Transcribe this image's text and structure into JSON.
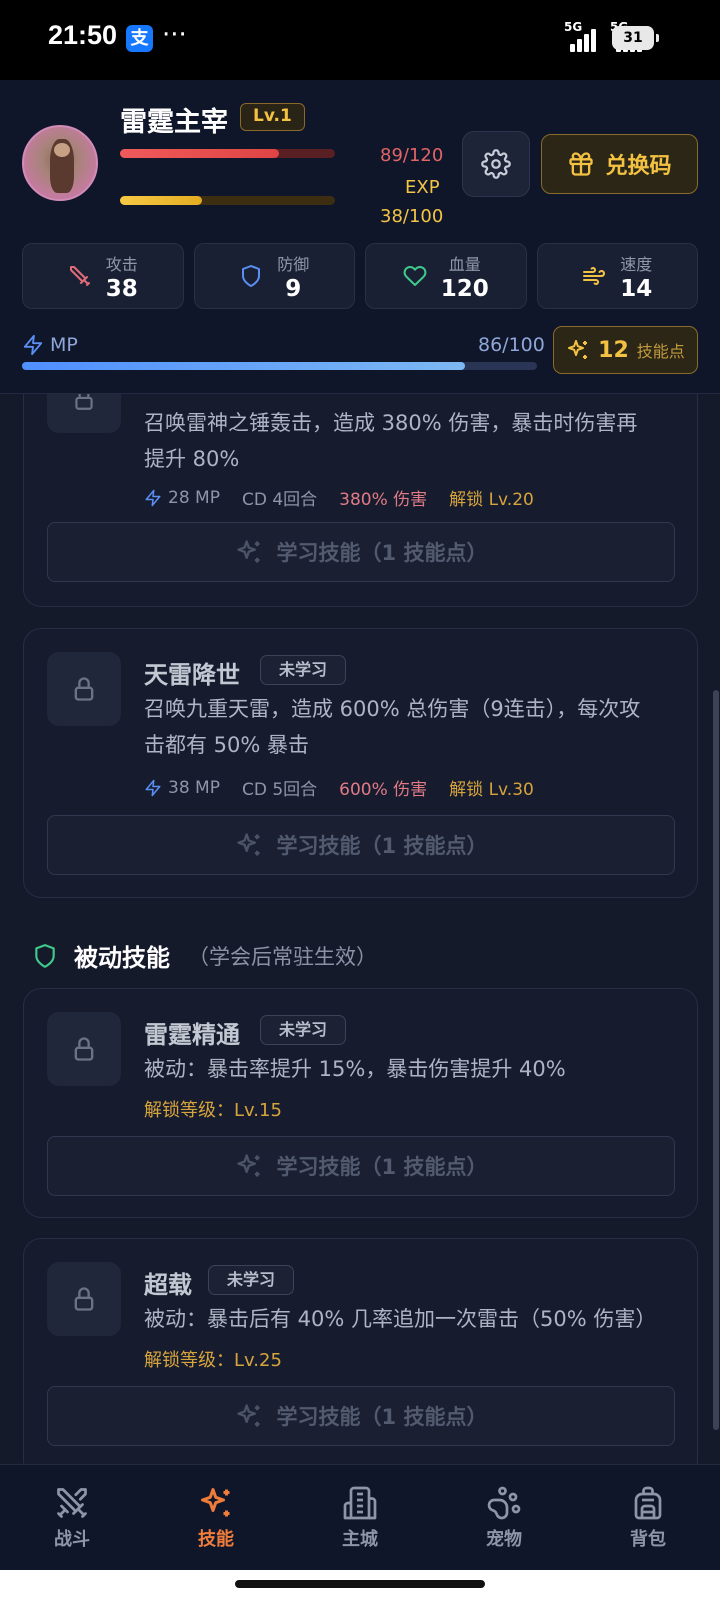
{
  "status_bar": {
    "time": "21:50",
    "app_badge": "支",
    "dots": "···",
    "signal1": "5G",
    "signal2": "5G",
    "battery": "31"
  },
  "player": {
    "name": "雷霆主宰",
    "level": "Lv.1",
    "hp_text": "89/120",
    "hp_fraction": 0.74,
    "exp_label": "EXP",
    "exp_text": "38/100",
    "exp_fraction": 0.38,
    "redeem_label": "兑换码"
  },
  "stats": [
    {
      "label": "攻击",
      "value": "38",
      "icon": "sword-icon",
      "color": "#e06c78"
    },
    {
      "label": "防御",
      "value": "9",
      "icon": "shield-icon",
      "color": "#5b8ff5"
    },
    {
      "label": "血量",
      "value": "120",
      "icon": "heart-icon",
      "color": "#3fc98a"
    },
    {
      "label": "速度",
      "value": "14",
      "icon": "wind-icon",
      "color": "#f4c242"
    }
  ],
  "mp": {
    "label": "MP",
    "text": "86/100",
    "fraction": 0.86
  },
  "skill_points": {
    "value": "12",
    "label": "技能点"
  },
  "active_skills": [
    {
      "name": "",
      "desc_line1": "召唤雷神之锤轰击，造成 380% 伤害，暴击时伤害再",
      "desc_line2": "提升 80%",
      "mp": "28 MP",
      "cd": "CD 4回合",
      "damage": "380% 伤害",
      "unlock": "解锁 Lv.20",
      "learn_label": "学习技能（1 技能点）"
    },
    {
      "name": "天雷降世",
      "tag": "未学习",
      "desc_line1": "召唤九重天雷，造成 600% 总伤害（9连击），每次攻",
      "desc_line2": "击都有 50% 暴击",
      "mp": "38 MP",
      "cd": "CD 5回合",
      "damage": "600% 伤害",
      "unlock": "解锁 Lv.30",
      "learn_label": "学习技能（1 技能点）"
    }
  ],
  "passive_section": {
    "title": "被动技能",
    "subtitle": "（学会后常驻生效）"
  },
  "passive_skills": [
    {
      "name": "雷霆精通",
      "tag": "未学习",
      "desc": "被动：暴击率提升 15%，暴击伤害提升 40%",
      "unlock": "解锁等级：Lv.15",
      "learn_label": "学习技能（1 技能点）"
    },
    {
      "name": "超载",
      "tag": "未学习",
      "desc": "被动：暴击后有 40% 几率追加一次雷击（50% 伤害）",
      "unlock": "解锁等级：Lv.25",
      "learn_label": "学习技能（1 技能点）"
    }
  ],
  "nav": [
    {
      "label": "战斗",
      "icon": "crossed-swords-icon",
      "active": false
    },
    {
      "label": "技能",
      "icon": "sparkles-icon",
      "active": true
    },
    {
      "label": "主城",
      "icon": "building-icon",
      "active": false
    },
    {
      "label": "宠物",
      "icon": "paw-icon",
      "active": false
    },
    {
      "label": "背包",
      "icon": "backpack-icon",
      "active": false
    }
  ],
  "colors": {
    "accent_orange": "#f07c3a",
    "gold": "#f4c242",
    "hp_red": "#e04444",
    "mp_blue": "#4f8fff",
    "background": "#151a2b"
  }
}
